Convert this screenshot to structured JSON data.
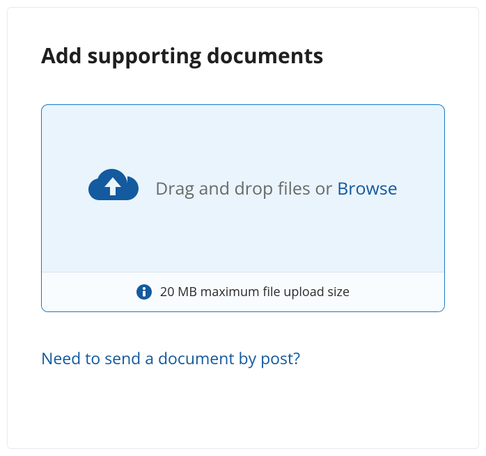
{
  "heading": "Add supporting documents",
  "dropzone": {
    "prompt_prefix": "Drag and drop files or ",
    "browse_label": "Browse",
    "hint": "20 MB maximum file upload size"
  },
  "post_link_label": "Need to send a document by post?"
}
